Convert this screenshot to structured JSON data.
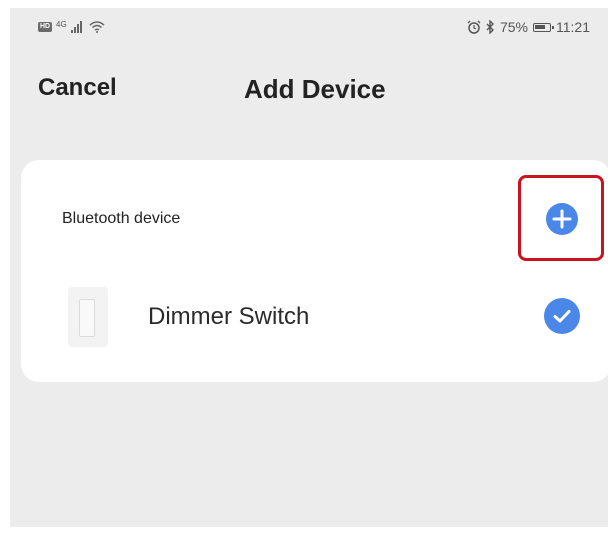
{
  "status_bar": {
    "network": "4G",
    "battery_percent": "75%",
    "time": "11:21"
  },
  "nav": {
    "cancel_label": "Cancel",
    "title": "Add Device"
  },
  "bluetooth_section": {
    "label": "Bluetooth device",
    "devices": [
      {
        "name": "Dimmer Switch",
        "selected": true
      }
    ]
  },
  "colors": {
    "accent": "#4a87e8",
    "highlight": "#c8141e",
    "background": "#ececed",
    "card": "#ffffff"
  }
}
